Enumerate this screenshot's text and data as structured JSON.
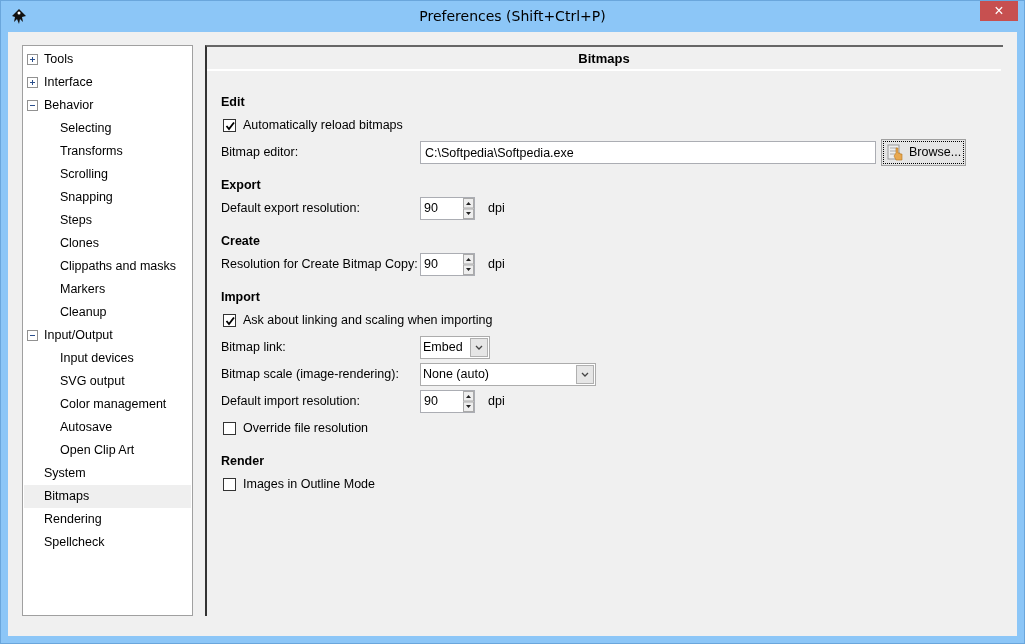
{
  "window": {
    "title": "Preferences (Shift+Ctrl+P)",
    "close": "×"
  },
  "sidebar": {
    "items": [
      {
        "label": "Tools",
        "expanded": false,
        "selected": false
      },
      {
        "label": "Interface",
        "expanded": false,
        "selected": false
      },
      {
        "label": "Behavior",
        "expanded": true,
        "selected": false,
        "children": [
          {
            "label": "Selecting",
            "selected": false
          },
          {
            "label": "Transforms",
            "selected": false
          },
          {
            "label": "Scrolling",
            "selected": false
          },
          {
            "label": "Snapping",
            "selected": false
          },
          {
            "label": "Steps",
            "selected": false
          },
          {
            "label": "Clones",
            "selected": false
          },
          {
            "label": "Clippaths and masks",
            "selected": false
          },
          {
            "label": "Markers",
            "selected": false
          },
          {
            "label": "Cleanup",
            "selected": false
          }
        ]
      },
      {
        "label": "Input/Output",
        "expanded": true,
        "selected": false,
        "children": [
          {
            "label": "Input devices",
            "selected": false
          },
          {
            "label": "SVG output",
            "selected": false
          },
          {
            "label": "Color management",
            "selected": false
          },
          {
            "label": "Autosave",
            "selected": false
          },
          {
            "label": "Open Clip Art",
            "selected": false
          }
        ]
      },
      {
        "label": "System",
        "selected": false
      },
      {
        "label": "Bitmaps",
        "selected": true
      },
      {
        "label": "Rendering",
        "selected": false
      },
      {
        "label": "Spellcheck",
        "selected": false
      }
    ]
  },
  "page": {
    "title": "Bitmaps",
    "sections": [
      {
        "title": "Edit",
        "rows": [
          {
            "kind": "checkbox",
            "label": "Automatically reload bitmaps",
            "checked": true
          },
          {
            "kind": "path",
            "label": "Bitmap editor:",
            "value": "C:\\Softpedia\\Softpedia.exe",
            "button": "Browse..."
          }
        ]
      },
      {
        "title": "Export",
        "rows": [
          {
            "kind": "spin",
            "label": "Default export resolution:",
            "value": "90",
            "unit": "dpi"
          }
        ]
      },
      {
        "title": "Create",
        "rows": [
          {
            "kind": "spin",
            "label": "Resolution for Create Bitmap Copy:",
            "value": "90",
            "unit": "dpi"
          }
        ]
      },
      {
        "title": "Import",
        "rows": [
          {
            "kind": "checkbox",
            "label": "Ask about linking and scaling when importing",
            "checked": true
          },
          {
            "kind": "dropdown",
            "label": "Bitmap link:",
            "value": "Embed"
          },
          {
            "kind": "combobox",
            "label": "Bitmap scale (image-rendering):",
            "value": "None (auto)"
          },
          {
            "kind": "spin",
            "label": "Default import resolution:",
            "value": "90",
            "unit": "dpi"
          },
          {
            "kind": "checkbox",
            "label": "Override file resolution",
            "checked": false
          }
        ]
      },
      {
        "title": "Render",
        "rows": [
          {
            "kind": "checkbox",
            "label": "Images in Outline Mode",
            "checked": false
          }
        ]
      }
    ]
  }
}
